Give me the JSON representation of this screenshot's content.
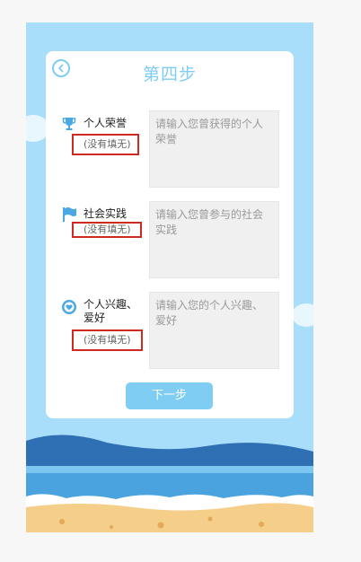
{
  "header": {
    "title": "第四步",
    "back_icon": "chevron-left-icon"
  },
  "fields": [
    {
      "icon": "trophy-icon",
      "label": "个人荣誉",
      "empty_note": "(没有填无)",
      "placeholder": "请输入您曾获得的个人荣誉"
    },
    {
      "icon": "flag-icon",
      "label": "社会实践",
      "empty_note": "(没有填无)",
      "placeholder": "请输入您曾参与的社会实践"
    },
    {
      "icon": "heart-icon",
      "label": "个人兴趣、爱好",
      "empty_note": "(没有填无)",
      "placeholder": "请输入您的个人兴趣、爱好"
    }
  ],
  "footer": {
    "next_label": "下一步"
  },
  "colors": {
    "accent": "#7fcdf2",
    "sky": "#a9defa",
    "highlight": "#d1291f",
    "sand": "#f5cf8a"
  }
}
